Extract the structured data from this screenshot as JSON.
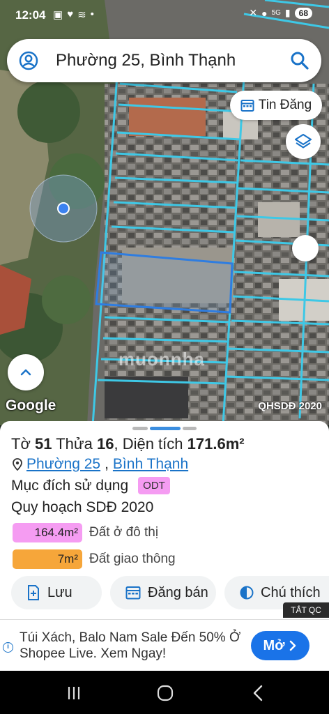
{
  "status_bar": {
    "time": "12:04",
    "network": "5G",
    "battery": "68"
  },
  "search": {
    "query": "Phường 25, Bình Thạnh"
  },
  "map": {
    "tin_dang_label": "Tin Đăng",
    "google_logo": "Google",
    "layer_label": "QHSDĐ 2020",
    "watermark": "muonnha",
    "parcel_color": "#3ec8e6",
    "selected_parcel_color": "#2f7de0"
  },
  "parcel": {
    "to_label": "Tờ",
    "to_value": "51",
    "thua_label": "Thửa",
    "thua_value": "16",
    "area_label": "Diện tích",
    "area_value": "171.6m²",
    "ward": "Phường 25",
    "district": "Bình Thạnh",
    "purpose_label": "Mục đích sử dụng",
    "purpose_code": "ODT",
    "plan_title": "Quy hoạch SDĐ 2020",
    "zones": [
      {
        "area": "164.4m²",
        "label": "Đất ở đô thị",
        "color": "#f59cf2"
      },
      {
        "area": "7m²",
        "label": "Đất giao thông",
        "color": "#f6a63a"
      }
    ]
  },
  "actions": {
    "save": "Lưu",
    "post_sale": "Đăng bán",
    "legend": "Chú thích"
  },
  "ad": {
    "close_label": "TẮT QC",
    "text": "Túi Xách, Balo Nam Sale Đến 50% Ở Shopee Live. Xem Ngay!",
    "cta": "Mở"
  },
  "colors": {
    "accent_blue": "#1a73e8",
    "handle_active": "#3b8ee0",
    "handle_inactive": "#b8b8b8"
  }
}
